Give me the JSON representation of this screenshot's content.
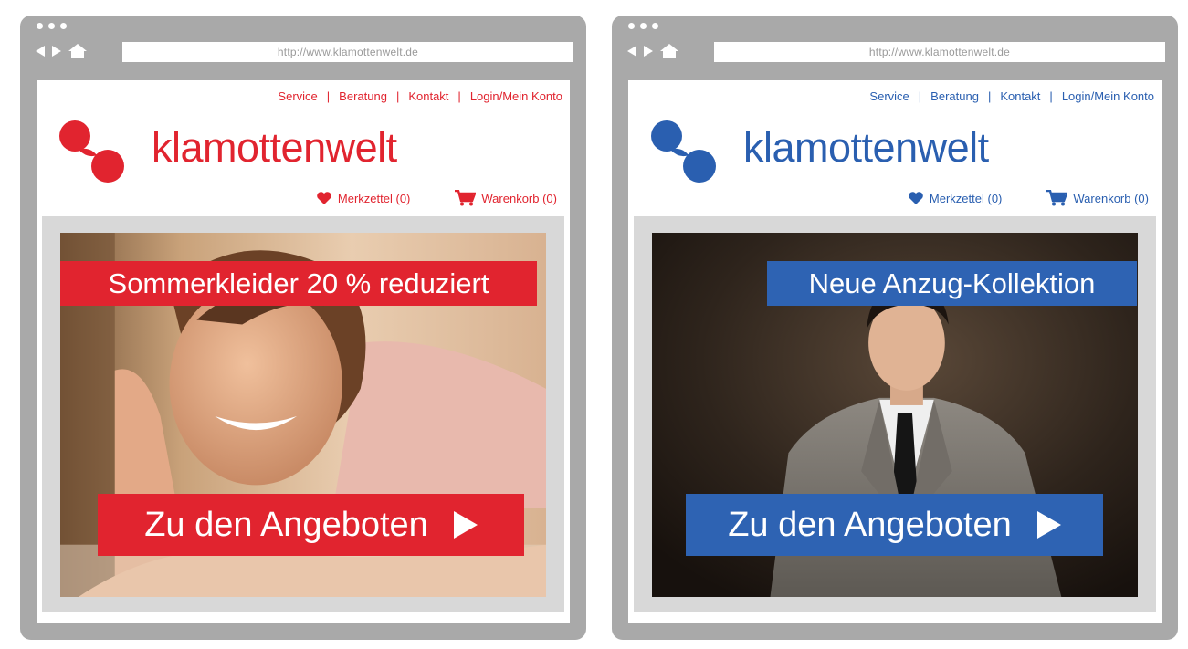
{
  "windows": [
    {
      "id": "red",
      "accent": "#e1242f",
      "address": "http://www.klamottenwelt.de",
      "nav": [
        "Service",
        "Beratung",
        "Kontakt",
        "Login/Mein Konto"
      ],
      "brand": "klamottenwelt",
      "wishlist": "Merkzettel (0)",
      "cart": "Warenkorb (0)",
      "headline": "Sommerkleider 20 % reduziert",
      "cta": "Zu den Angeboten"
    },
    {
      "id": "blue",
      "accent": "#2e63b3",
      "address": "http://www.klamottenwelt.de",
      "nav": [
        "Service",
        "Beratung",
        "Kontakt",
        "Login/Mein Konto"
      ],
      "brand": "klamottenwelt",
      "wishlist": "Merkzettel (0)",
      "cart": "Warenkorb (0)",
      "headline": "Neue Anzug-Kollektion",
      "cta": "Zu den Angeboten"
    }
  ]
}
